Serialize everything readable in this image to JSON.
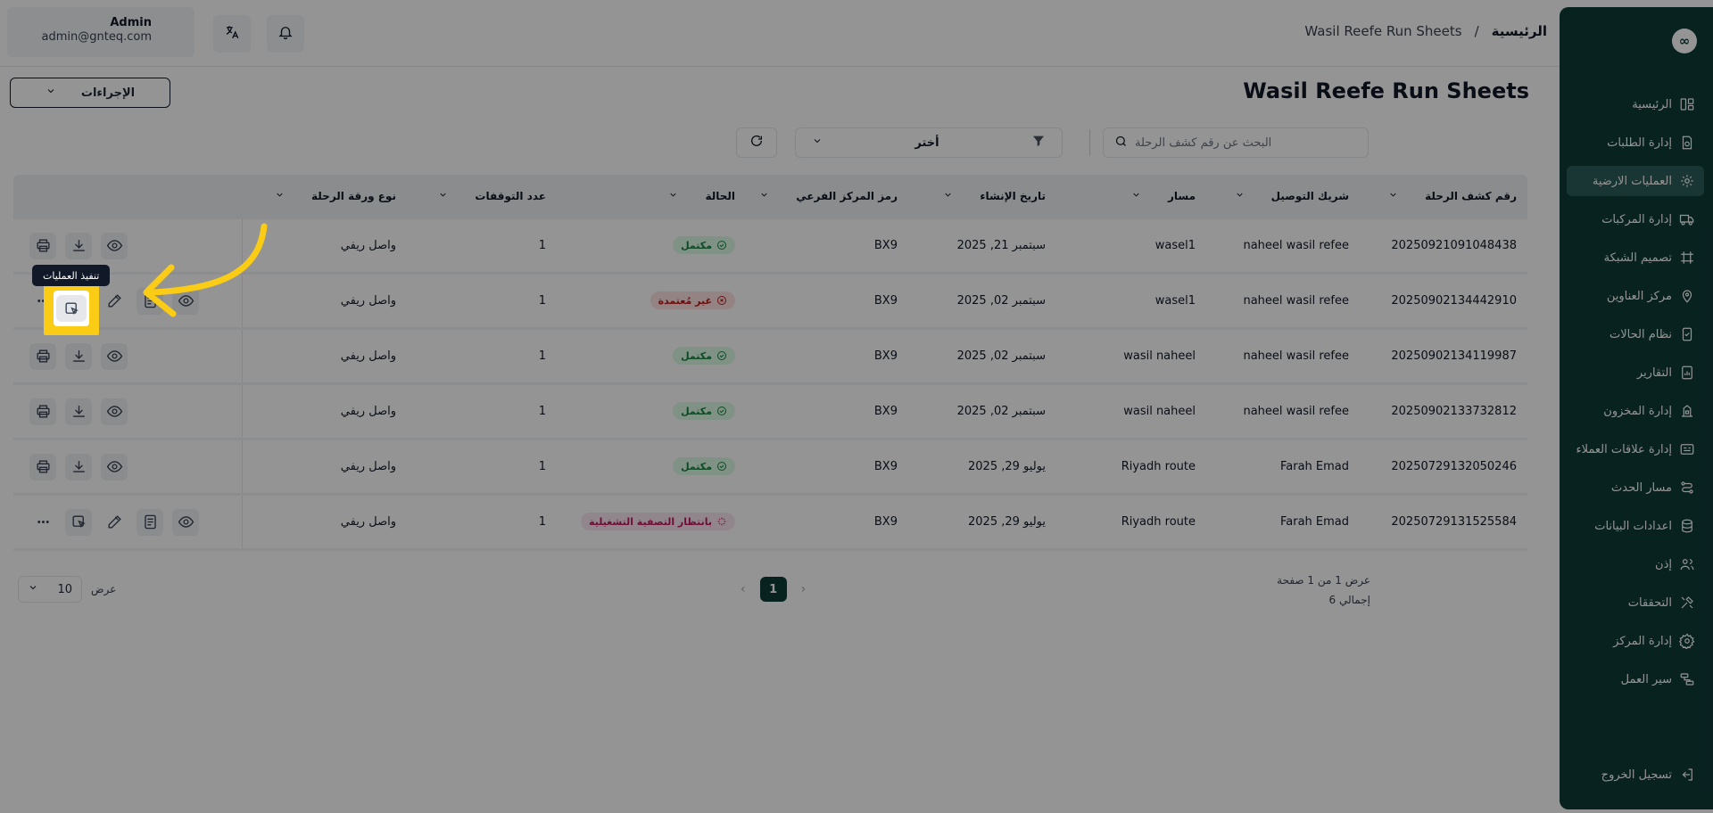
{
  "app": {
    "logo_glyph": "∞",
    "accent_color": "#0f3b38"
  },
  "header": {
    "user_name": "Admin",
    "user_email": "admin@gnteq.com",
    "breadcrumb_home": "الرئيسية",
    "breadcrumb_sep": "/",
    "breadcrumb_current": "Wasil Reefe Run Sheets"
  },
  "sidebar": {
    "items": [
      {
        "label": "الرئيسية",
        "icon": "layout-icon"
      },
      {
        "label": "إدارة الطلبات",
        "icon": "orders-icon"
      },
      {
        "label": "العمليات الارضية",
        "icon": "ground-ops-icon"
      },
      {
        "label": "إدارة المركبات",
        "icon": "truck-icon"
      },
      {
        "label": "تصميم الشبكة",
        "icon": "network-icon"
      },
      {
        "label": "مركز العناوين",
        "icon": "location-icon"
      },
      {
        "label": "نظام الحالات",
        "icon": "status-icon"
      },
      {
        "label": "التقارير",
        "icon": "reports-icon"
      },
      {
        "label": "إدارة المخزون",
        "icon": "inventory-icon"
      },
      {
        "label": "إدارة علاقات العملاء",
        "icon": "crm-icon"
      },
      {
        "label": "مسار الحدث",
        "icon": "route-icon"
      },
      {
        "label": "اعدادات البيانات",
        "icon": "database-icon"
      },
      {
        "label": "إذن",
        "icon": "users-icon"
      },
      {
        "label": "التحققات",
        "icon": "tools-icon"
      },
      {
        "label": "إدارة المركز",
        "icon": "settings-icon"
      },
      {
        "label": "سير العمل",
        "icon": "workflow-icon"
      }
    ],
    "active_index": 2,
    "logout_label": "تسجيل الخروج"
  },
  "page": {
    "title": "Wasil Reefe Run Sheets",
    "actions_label": "الإجراءات",
    "search_placeholder": "البحث عن رقم كشف الرحلة",
    "filter_label": "أختر"
  },
  "table": {
    "headers": [
      "رقم كشف الرحلة",
      "شريك التوصيل",
      "مسار",
      "تاريخ الإنشاء",
      "رمز المركز الفرعي",
      "الحالة",
      "عدد التوقفات",
      "نوع ورقة الرحلة"
    ],
    "rows": [
      {
        "id": "20250921091048438",
        "partner": "naheel wasil refee",
        "route": "wasel1",
        "date": "سبتمبر 21, 2025",
        "branch": "BX9",
        "status": "مكتمل",
        "status_type": "done",
        "stops": "1",
        "type": "واصل ريفي"
      },
      {
        "id": "20250902134442910",
        "partner": "naheel wasil refee",
        "route": "wasel1",
        "date": "سبتمبر 02, 2025",
        "branch": "BX9",
        "status": "غير مُعتمدة",
        "status_type": "rejected",
        "stops": "1",
        "type": "واصل ريفي"
      },
      {
        "id": "20250902134119987",
        "partner": "naheel wasil refee",
        "route": "wasil naheel",
        "date": "سبتمبر 02, 2025",
        "branch": "BX9",
        "status": "مكتمل",
        "status_type": "done",
        "stops": "1",
        "type": "واصل ريفي"
      },
      {
        "id": "20250902133732812",
        "partner": "naheel wasil refee",
        "route": "wasil naheel",
        "date": "سبتمبر 02, 2025",
        "branch": "BX9",
        "status": "مكتمل",
        "status_type": "done",
        "stops": "1",
        "type": "واصل ريفي"
      },
      {
        "id": "20250729132050246",
        "partner": "Farah Emad",
        "route": "Riyadh route",
        "date": "يوليو 29, 2025",
        "branch": "BX9",
        "status": "مكتمل",
        "status_type": "done",
        "stops": "1",
        "type": "واصل ريفي"
      },
      {
        "id": "20250729131525584",
        "partner": "Farah Emad",
        "route": "Riyadh route",
        "date": "يوليو 29, 2025",
        "branch": "BX9",
        "status": "بانتظار التصفية التشغيلية",
        "status_type": "pending",
        "stops": "1",
        "type": "واصل ريفي"
      }
    ]
  },
  "pagination": {
    "summary": "عرض 1 من 1 صفحة",
    "total": "إجمالي 6",
    "current_page": "1",
    "page_size": "10",
    "page_size_label": "عرض"
  },
  "tutorial": {
    "tooltip": "تنفيذ العمليات",
    "arrow_color": "#facc15"
  }
}
